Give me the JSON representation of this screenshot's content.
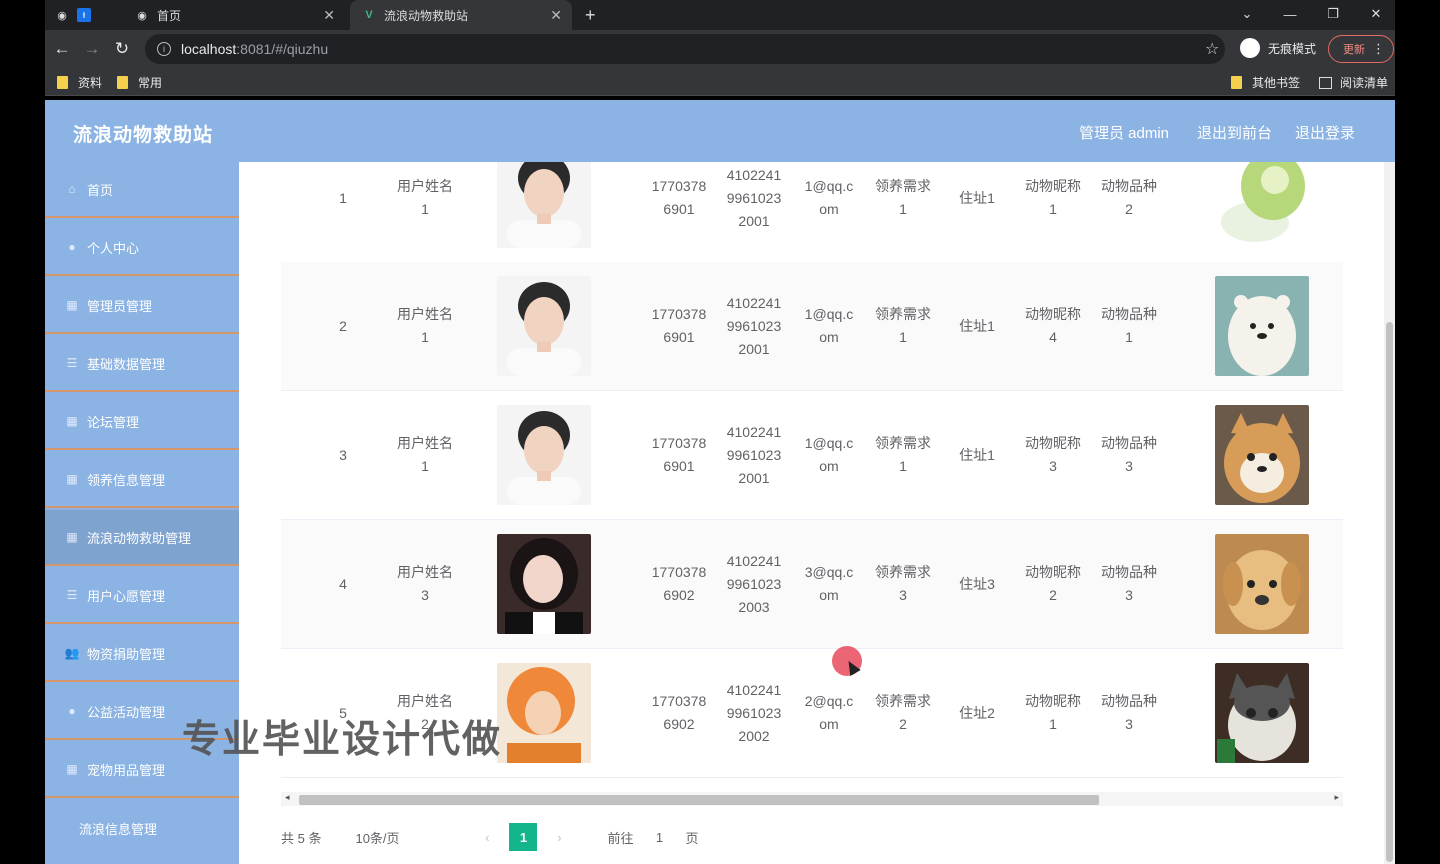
{
  "browser": {
    "tabs": [
      {
        "label": "首页"
      },
      {
        "label": "流浪动物救助站"
      }
    ],
    "url_host": "localhost",
    "url_path": ":8081/#/qiuzhu",
    "incognito_label": "无痕模式",
    "update_label": "更新",
    "bookmarks": [
      "资料",
      "常用"
    ],
    "bookmarks_right": [
      "其他书签",
      "阅读清单"
    ]
  },
  "app": {
    "title": "流浪动物救助站",
    "header_links": [
      "管理员 admin",
      "退出到前台",
      "退出登录"
    ]
  },
  "sidebar": {
    "items": [
      {
        "label": "首页",
        "icon": "home-icon"
      },
      {
        "label": "个人中心",
        "icon": "user-icon"
      },
      {
        "label": "管理员管理",
        "icon": "grid-icon"
      },
      {
        "label": "基础数据管理",
        "icon": "list-icon"
      },
      {
        "label": "论坛管理",
        "icon": "grid-icon"
      },
      {
        "label": "领养信息管理",
        "icon": "grid-icon"
      },
      {
        "label": "流浪动物救助管理",
        "icon": "grid-icon"
      },
      {
        "label": "用户心愿管理",
        "icon": "list-icon"
      },
      {
        "label": "物资捐助管理",
        "icon": "users-icon"
      },
      {
        "label": "公益活动管理",
        "icon": "user-icon"
      },
      {
        "label": "宠物用品管理",
        "icon": "grid-icon"
      },
      {
        "label": "流浪信息管理",
        "icon": "grid-icon"
      }
    ]
  },
  "table": {
    "rows": [
      {
        "index": "1",
        "name": "用户姓名\n1",
        "phone": "1770378\n6901",
        "idcard": "4102241\n9961023\n2001",
        "email": "1@qq.c\nom",
        "need": "领养需求\n1",
        "address": "住址1",
        "pet_name": "动物昵称\n1",
        "breed": "动物品种\n2",
        "avatar": "male",
        "pet": "cabbage"
      },
      {
        "index": "2",
        "name": "用户姓名\n1",
        "phone": "1770378\n6901",
        "idcard": "4102241\n9961023\n2001",
        "email": "1@qq.c\nom",
        "need": "领养需求\n1",
        "address": "住址1",
        "pet_name": "动物昵称\n4",
        "breed": "动物品种\n1",
        "avatar": "male",
        "pet": "bear"
      },
      {
        "index": "3",
        "name": "用户姓名\n1",
        "phone": "1770378\n6901",
        "idcard": "4102241\n9961023\n2001",
        "email": "1@qq.c\nom",
        "need": "领养需求\n1",
        "address": "住址1",
        "pet_name": "动物昵称\n3",
        "breed": "动物品种\n3",
        "avatar": "male",
        "pet": "shiba"
      },
      {
        "index": "4",
        "name": "用户姓名\n3",
        "phone": "1770378\n6902",
        "idcard": "4102241\n9961023\n2003",
        "email": "3@qq.c\nom",
        "need": "领养需求\n3",
        "address": "住址3",
        "pet_name": "动物昵称\n2",
        "breed": "动物品种\n3",
        "avatar": "female",
        "pet": "puppy"
      },
      {
        "index": "5",
        "name": "用户姓名\n2",
        "phone": "1770378\n6902",
        "idcard": "4102241\n9961023\n2002",
        "email": "2@qq.c\nom",
        "need": "领养需求\n2",
        "address": "住址2",
        "pet_name": "动物昵称\n1",
        "breed": "动物品种\n3",
        "avatar": "orange",
        "pet": "cat"
      }
    ]
  },
  "pagination": {
    "total": "共 5 条",
    "page_size": "10条/页",
    "current": "1",
    "goto_label": "前往",
    "goto_value": "1",
    "page_suffix": "页"
  },
  "overlay": {
    "watermark": "专业毕业设计代做"
  },
  "colors": {
    "header": "#8bb3e3",
    "sidebar": "#8bb3e3",
    "active_page": "#13b58a",
    "divider": "#d4956f"
  }
}
